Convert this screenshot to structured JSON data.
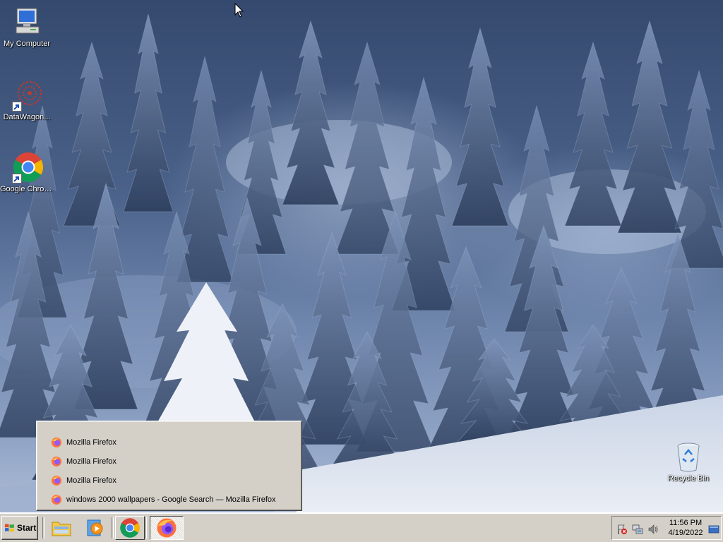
{
  "desktop": {
    "icons": [
      {
        "name": "my-computer",
        "label": "My Computer",
        "icon": "computer-icon"
      },
      {
        "name": "datawagon",
        "label": "DataWagon...",
        "icon": "datawagon-icon"
      },
      {
        "name": "google-chrome",
        "label": "Google Chrome",
        "icon": "chrome-icon"
      },
      {
        "name": "recycle-bin",
        "label": "Recycle Bin",
        "icon": "recycle-bin-icon"
      }
    ]
  },
  "jump_list": {
    "items": [
      {
        "label": "Mozilla Firefox",
        "icon": "firefox-icon"
      },
      {
        "label": "Mozilla Firefox",
        "icon": "firefox-icon"
      },
      {
        "label": "Mozilla Firefox",
        "icon": "firefox-icon"
      },
      {
        "label": "windows 2000 wallpapers - Google Search — Mozilla Firefox",
        "icon": "firefox-icon"
      }
    ]
  },
  "taskbar": {
    "start_label": "Start",
    "quick_launch": [
      "explorer-icon",
      "media-player-icon"
    ],
    "apps": [
      "chrome-icon",
      "firefox-icon"
    ]
  },
  "tray": {
    "time": "11:56 PM",
    "date": "4/19/2022",
    "icons": [
      "security-alert-icon",
      "network-icon",
      "volume-icon",
      "show-desktop-icon"
    ]
  },
  "colors": {
    "taskbar": "#d4d0c8",
    "firefox_orange": "#ff7139",
    "firefox_purple": "#9059ff"
  }
}
